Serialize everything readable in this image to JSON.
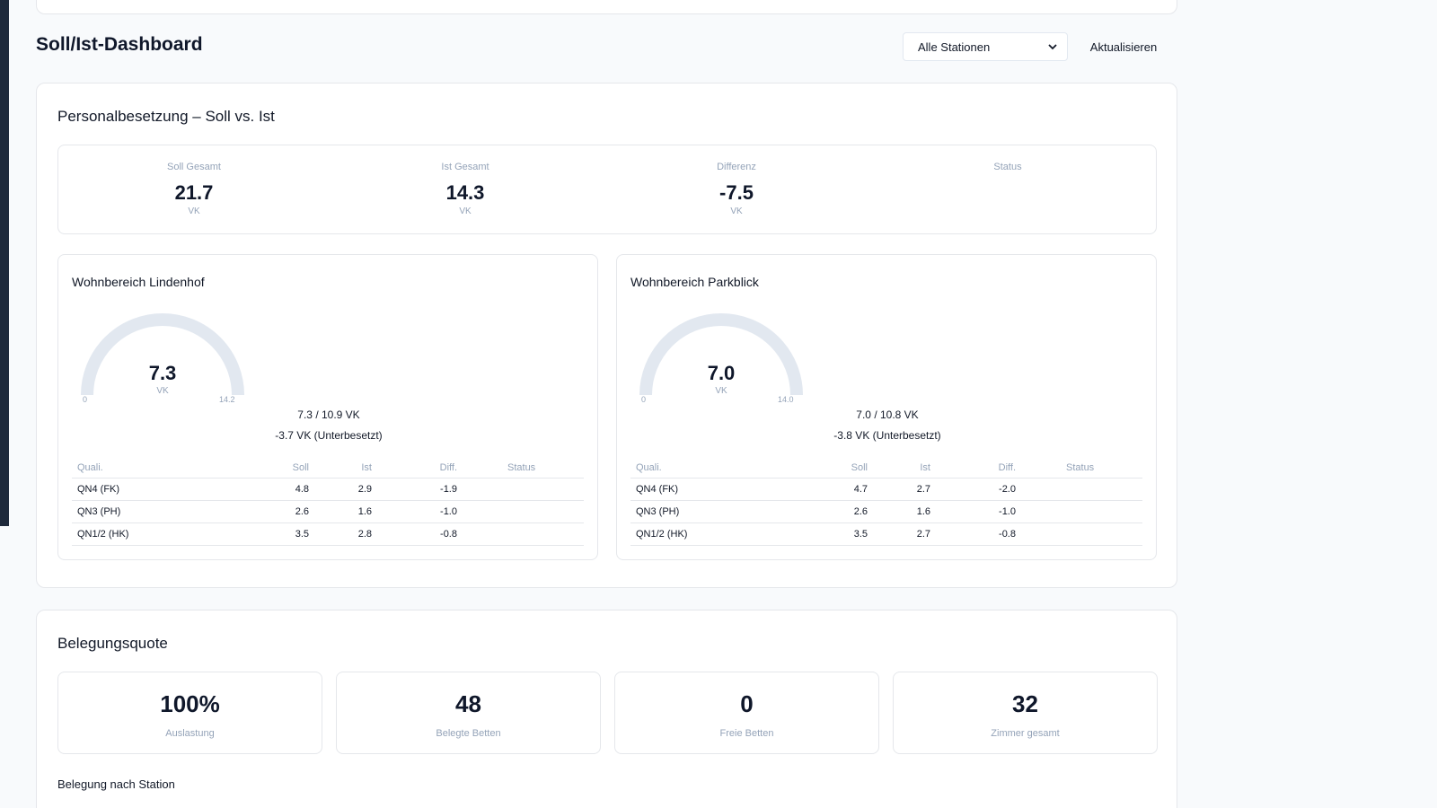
{
  "header": {
    "title": "Soll/Ist-Dashboard",
    "station_select": "Alle Stationen",
    "refresh_label": "Aktualisieren"
  },
  "staffing": {
    "title": "Personalbesetzung – Soll vs. Ist",
    "summary": [
      {
        "label": "Soll Gesamt",
        "value": "21.7",
        "unit": "VK"
      },
      {
        "label": "Ist Gesamt",
        "value": "14.3",
        "unit": "VK"
      },
      {
        "label": "Differenz",
        "value": "-7.5",
        "unit": "VK"
      },
      {
        "label": "Status",
        "value": "",
        "unit": ""
      }
    ],
    "columns": [
      "Quali.",
      "Soll",
      "Ist",
      "Diff.",
      "Status"
    ],
    "wards": [
      {
        "name": "Wohnbereich Lindenhof",
        "gauge_value": "7.3",
        "gauge_unit": "VK",
        "gauge_min": "0",
        "gauge_max": "14.2",
        "ratio": "7.3 / 10.9 VK",
        "delta": "-3.7 VK (Unterbesetzt)",
        "rows": [
          {
            "quali": "QN4 (FK)",
            "soll": "4.8",
            "ist": "2.9",
            "diff": "-1.9",
            "status": ""
          },
          {
            "quali": "QN3 (PH)",
            "soll": "2.6",
            "ist": "1.6",
            "diff": "-1.0",
            "status": ""
          },
          {
            "quali": "QN1/2 (HK)",
            "soll": "3.5",
            "ist": "2.8",
            "diff": "-0.8",
            "status": ""
          }
        ]
      },
      {
        "name": "Wohnbereich Parkblick",
        "gauge_value": "7.0",
        "gauge_unit": "VK",
        "gauge_min": "0",
        "gauge_max": "14.0",
        "ratio": "7.0 / 10.8 VK",
        "delta": "-3.8 VK (Unterbesetzt)",
        "rows": [
          {
            "quali": "QN4 (FK)",
            "soll": "4.7",
            "ist": "2.7",
            "diff": "-2.0",
            "status": ""
          },
          {
            "quali": "QN3 (PH)",
            "soll": "2.6",
            "ist": "1.6",
            "diff": "-1.0",
            "status": ""
          },
          {
            "quali": "QN1/2 (HK)",
            "soll": "3.5",
            "ist": "2.7",
            "diff": "-0.8",
            "status": ""
          }
        ]
      }
    ]
  },
  "occupancy": {
    "title": "Belegungsquote",
    "kpis": [
      {
        "value": "100%",
        "label": "Auslastung"
      },
      {
        "value": "48",
        "label": "Belegte Betten"
      },
      {
        "value": "0",
        "label": "Freie Betten"
      },
      {
        "value": "32",
        "label": "Zimmer gesamt"
      }
    ],
    "by_station_title": "Belegung nach Station"
  },
  "colors": {
    "gauge_track": "#e2e8f0",
    "sidebar": "#1e293b",
    "muted_text": "#94a3b8"
  }
}
